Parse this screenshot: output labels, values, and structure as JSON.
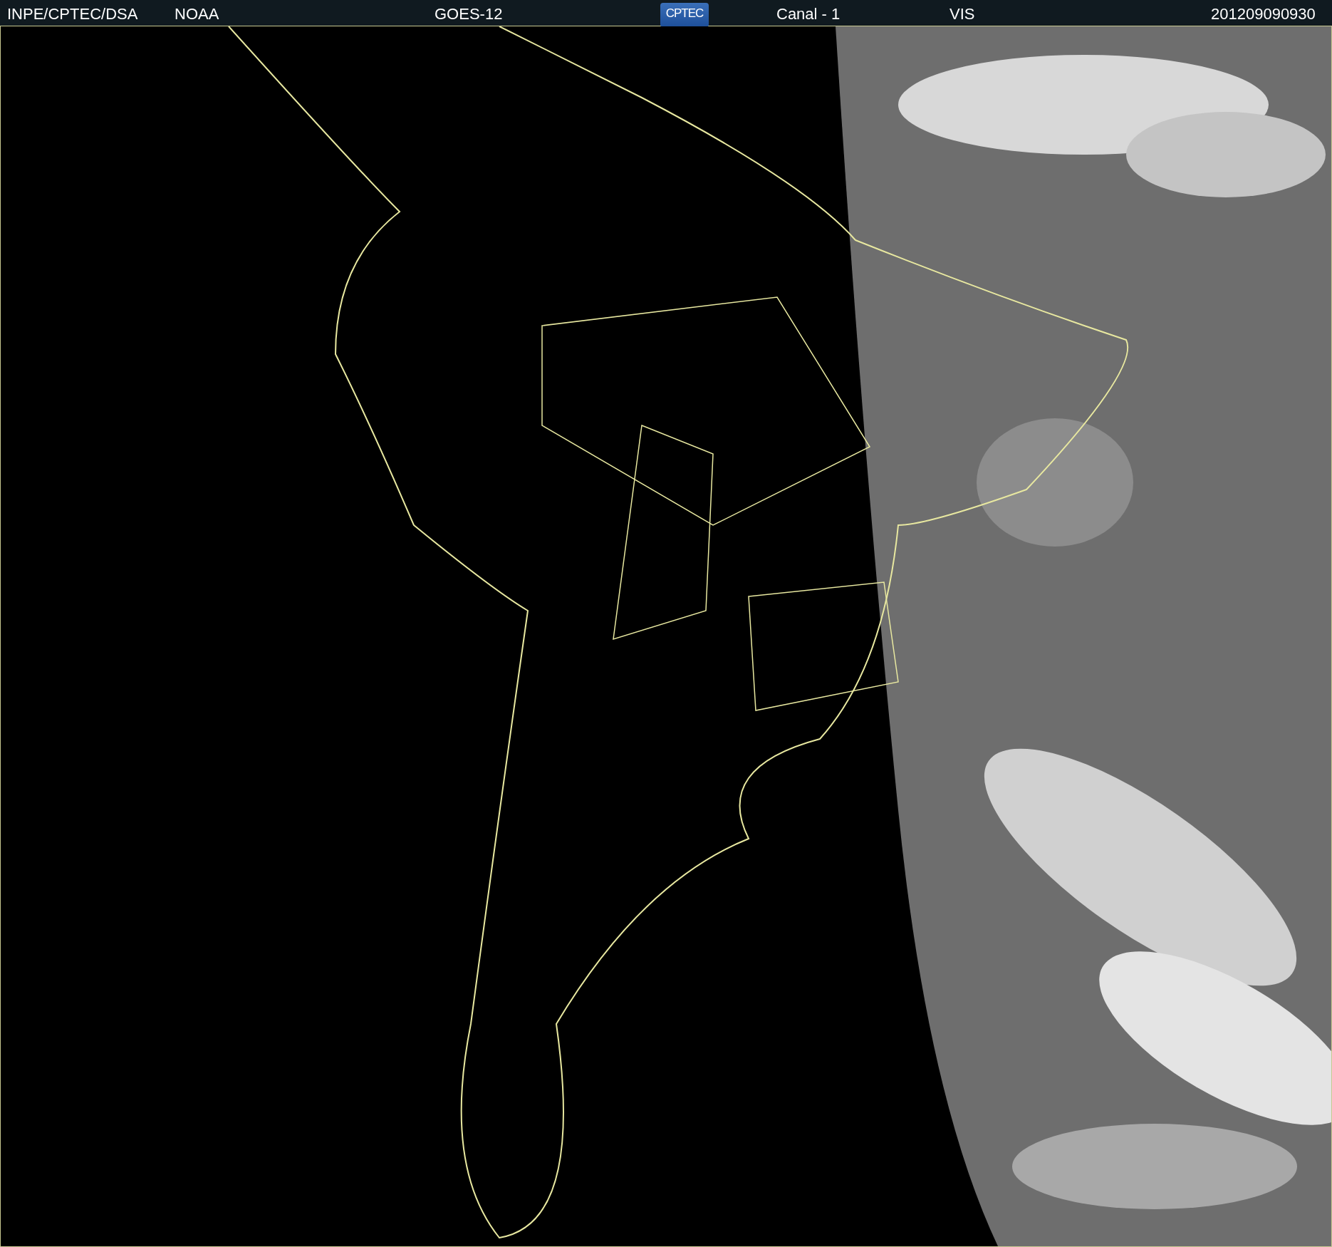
{
  "header": {
    "items": [
      {
        "kind": "text",
        "text": "INPE/CPTEC/DSA"
      },
      {
        "kind": "text",
        "text": "NOAA"
      },
      {
        "kind": "text",
        "text": "GOES-12"
      },
      {
        "kind": "logo",
        "text": "CPTEC"
      },
      {
        "kind": "text",
        "text": "Canal - 1"
      },
      {
        "kind": "text",
        "text": "VIS"
      },
      {
        "kind": "text",
        "text": "201209090930"
      }
    ]
  }
}
